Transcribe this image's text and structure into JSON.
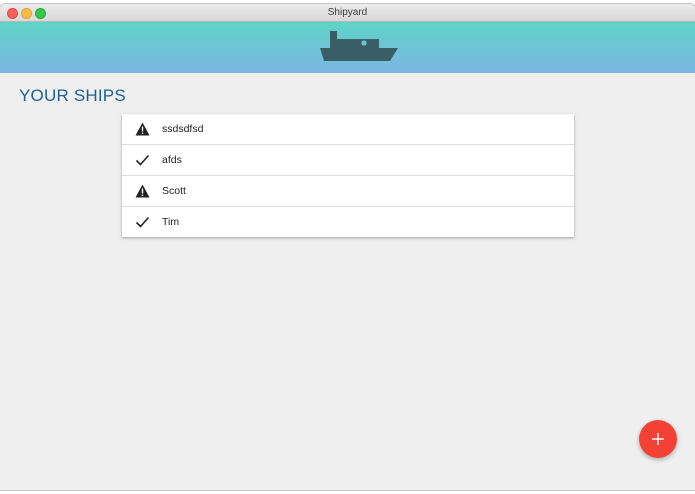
{
  "window": {
    "title": "Shipyard"
  },
  "header": {
    "logo_icon": "ship-icon"
  },
  "main": {
    "heading": "YOUR SHIPS",
    "ships": [
      {
        "name": "ssdsdfsd",
        "status_icon": "warning-icon"
      },
      {
        "name": "afds",
        "status_icon": "check-icon"
      },
      {
        "name": "Scott",
        "status_icon": "warning-icon"
      },
      {
        "name": "Tim",
        "status_icon": "check-icon"
      }
    ]
  },
  "fab": {
    "icon": "plus-icon",
    "color": "#f34235"
  },
  "colors": {
    "banner_start": "#5fd4c4",
    "banner_end": "#7db6e3",
    "heading": "#1e5f93",
    "ship_logo": "#3a5e66"
  }
}
